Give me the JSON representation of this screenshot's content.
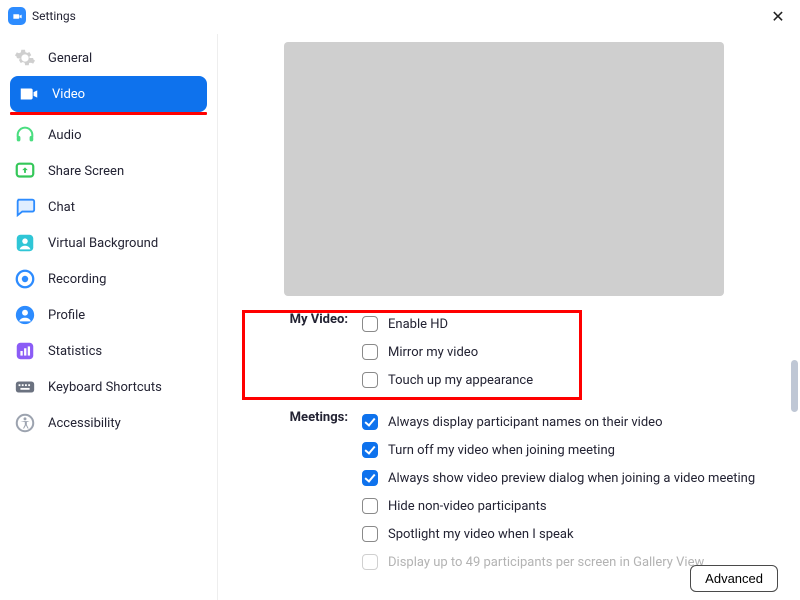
{
  "window": {
    "title": "Settings"
  },
  "sidebar": {
    "items": [
      {
        "label": "General"
      },
      {
        "label": "Video"
      },
      {
        "label": "Audio"
      },
      {
        "label": "Share Screen"
      },
      {
        "label": "Chat"
      },
      {
        "label": "Virtual Background"
      },
      {
        "label": "Recording"
      },
      {
        "label": "Profile"
      },
      {
        "label": "Statistics"
      },
      {
        "label": "Keyboard Shortcuts"
      },
      {
        "label": "Accessibility"
      }
    ],
    "active_index": 1
  },
  "video_settings": {
    "sections": {
      "my_video": {
        "label": "My Video:",
        "options": [
          {
            "label": "Enable HD",
            "checked": false
          },
          {
            "label": "Mirror my video",
            "checked": false
          },
          {
            "label": "Touch up my appearance",
            "checked": false
          }
        ]
      },
      "meetings": {
        "label": "Meetings:",
        "options": [
          {
            "label": "Always display participant names on their video",
            "checked": true
          },
          {
            "label": "Turn off my video when joining meeting",
            "checked": true
          },
          {
            "label": "Always show video preview dialog when joining a video meeting",
            "checked": true
          },
          {
            "label": "Hide non-video participants",
            "checked": false
          },
          {
            "label": "Spotlight my video when I speak",
            "checked": false
          },
          {
            "label": "Display up to 49 participants per screen in Gallery View",
            "checked": false,
            "disabled": true
          }
        ]
      }
    }
  },
  "buttons": {
    "advanced": "Advanced"
  }
}
